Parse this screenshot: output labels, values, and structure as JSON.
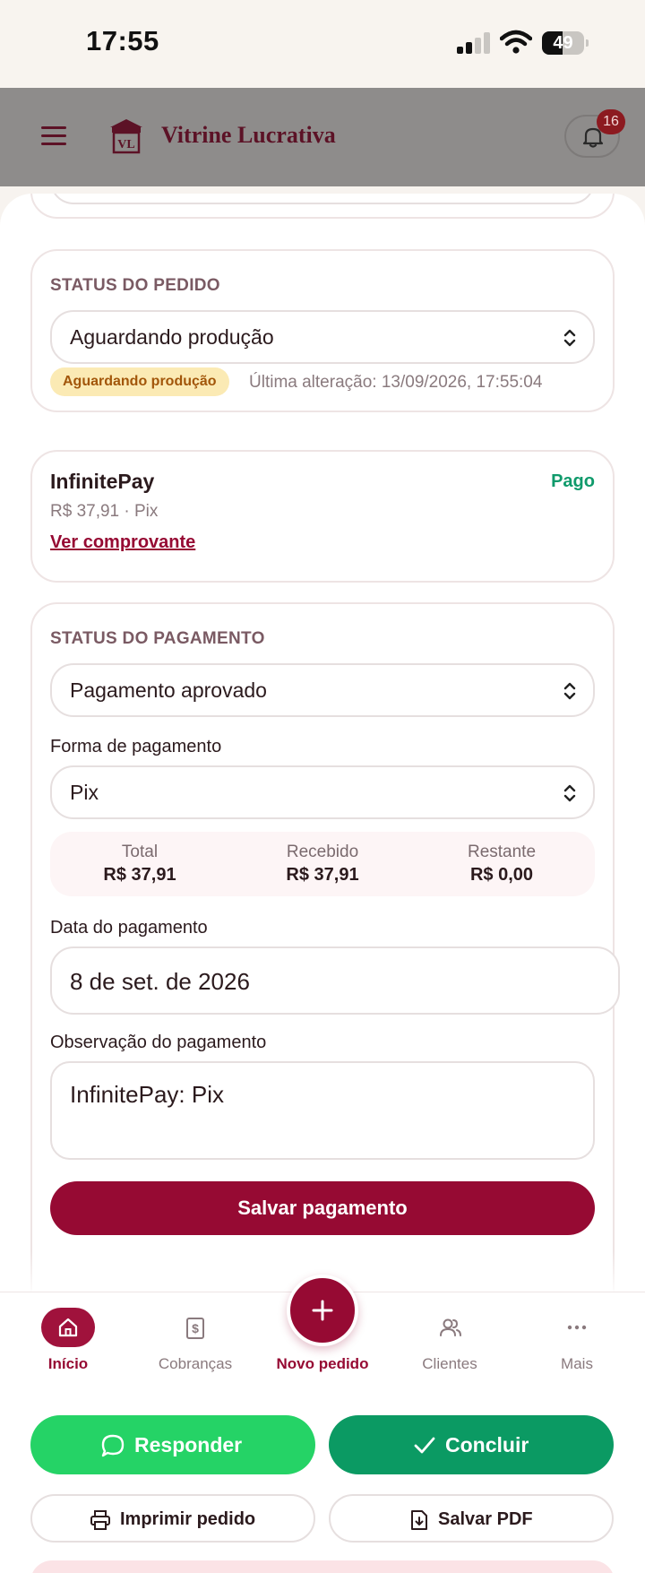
{
  "status_bar": {
    "time": "17:55",
    "battery": "49",
    "battery_level": 0.49
  },
  "header": {
    "brand": "Vitrine Lucrativa",
    "logo_text": "VL",
    "notification_count": "16"
  },
  "order_status": {
    "section_label": "STATUS DO PEDIDO",
    "selected": "Aguardando produção",
    "pill": "Aguardando produção",
    "last_change": "Última alteração: 13/09/2026, 17:55:04"
  },
  "payment_info": {
    "provider": "InfinitePay",
    "status": "Pago",
    "amount_method": "R$ 37,91 · Pix",
    "receipt_link": "Ver comprovante"
  },
  "payment_status": {
    "section_label": "STATUS DO PAGAMENTO",
    "selected": "Pagamento aprovado",
    "method_label": "Forma de pagamento",
    "method": "Pix",
    "summary": [
      {
        "title": "Total",
        "value": "R$ 37,91"
      },
      {
        "title": "Recebido",
        "value": "R$ 37,91"
      },
      {
        "title": "Restante",
        "value": "R$ 0,00"
      }
    ],
    "date_label": "Data do pagamento",
    "date": "8 de set. de 2026",
    "note_label": "Observação do pagamento",
    "note": "InfinitePay: Pix",
    "save_label": "Salvar pagamento"
  },
  "bottom_nav": {
    "items": [
      {
        "label": "Início",
        "icon": "home-icon",
        "active": true
      },
      {
        "label": "Cobranças",
        "icon": "dollar-doc-icon"
      },
      {
        "label": "Novo pedido",
        "icon": "plus-icon"
      },
      {
        "label": "Clientes",
        "icon": "users-icon"
      },
      {
        "label": "Mais",
        "icon": "more-icon"
      }
    ]
  },
  "actions": {
    "reply": "Responder",
    "complete": "Concluir",
    "print": "Imprimir pedido",
    "pdf": "Salvar PDF"
  },
  "colors": {
    "primary": "#960a33",
    "whatsapp_green": "#25d366",
    "complete_green": "#0b9a63",
    "paid_green": "#0f9a6b",
    "pending_pill_bg": "#fbeab4",
    "pending_pill_text": "#a2560a"
  }
}
